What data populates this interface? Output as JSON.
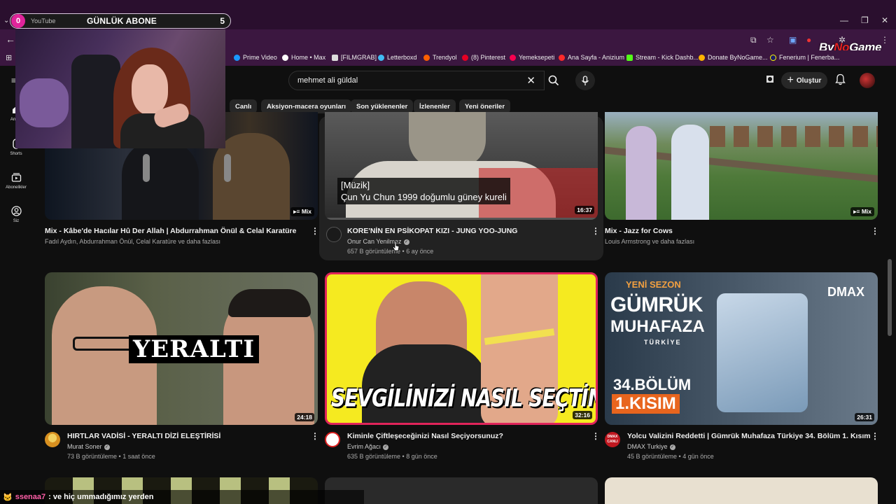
{
  "browser": {
    "tab_badge": "0",
    "tab_site": "YouTube",
    "tab_title": "GÜNLÜK ABONE",
    "tab_count": "5",
    "bookmarks": [
      {
        "label": "Prime Video",
        "color": "#1a98ff"
      },
      {
        "label": "Home • Max",
        "color": "#ffffff"
      },
      {
        "label": "[FILMGRAB]",
        "color": "#dddddd"
      },
      {
        "label": "Letterboxd",
        "color": "#40bcf4"
      },
      {
        "label": "Trendyol",
        "color": "#ff6000"
      },
      {
        "label": "(8) Pinterest",
        "color": "#e60023"
      },
      {
        "label": "Yemeksepeti",
        "color": "#fa0050"
      },
      {
        "label": "Ana Sayfa - Anizium",
        "color": "#ff2a2a"
      },
      {
        "label": "Stream - Kick Dashb...",
        "color": "#53fc18"
      },
      {
        "label": "Donate ByNoGame...",
        "color": "#ffb400"
      },
      {
        "label": "Fenerium | Fenerba...",
        "color": "#1a1a6a"
      }
    ],
    "watermark_a": "By",
    "watermark_b": "No",
    "watermark_c": "Game"
  },
  "header": {
    "search_value": "mehmet ali güldal",
    "create_label": "Oluştur"
  },
  "chips": [
    "Canlı",
    "Aksiyon-macera oyunları",
    "Son yüklenenler",
    "İzlenenler",
    "Yeni öneriler"
  ],
  "guide": [
    {
      "label": "Ana S",
      "icon": "home-icon"
    },
    {
      "label": "Shorts",
      "icon": "shorts-icon"
    },
    {
      "label": "Abonelikler",
      "icon": "subscriptions-icon"
    },
    {
      "label": "Siz",
      "icon": "you-icon"
    }
  ],
  "videos": [
    {
      "title": "Mix - Kâbe'de Hacılar Hû Der Allah | Abdurrahman Önül & Celal Karatüre",
      "meta1": "Fadıl Aydın, Abdurrahman Önül, Celal Karatüre ve daha fazlası",
      "badge": "Mix"
    },
    {
      "title": "KORE'NİN EN PSİKOPAT KIZI - JUNG YOO-JUNG",
      "channel": "Onur Can Yenilmez",
      "stats": "657 B görüntüleme • 6 ay önce",
      "duration": "16:37",
      "overlay_tag": "[Müzik]",
      "overlay_caption": "Çun Yu Chun 1999 doğumlu güney kureli"
    },
    {
      "title": "Mix - Jazz for Cows",
      "meta1": "Louis Armstrong ve daha fazlası",
      "badge": "Mix"
    },
    {
      "title": "HIRTLAR VADİSİ - YERALTI DİZİ ELEŞTİRİSİ",
      "channel": "Murat Soner",
      "stats": "73 B görüntüleme • 1 saat önce",
      "duration": "24:18",
      "thumb_text": "YERALTI"
    },
    {
      "title": "Kiminle Çiftleşeceğinizi Nasıl Seçiyorsunuz?",
      "channel": "Evrim Ağacı",
      "stats": "635 B görüntüleme • 8 gün önce",
      "duration": "32:16",
      "thumb_text": "SEVGİLİNİZİ NASIL SEÇTİNİZ?"
    },
    {
      "title": "Yolcu Valizini Reddetti | Gümrük Muhafaza Türkiye 34. Bölüm 1. Kısım",
      "channel": "DMAX Turkiye",
      "stats": "45 B görüntüleme • 4 gün önce",
      "duration": "26:31",
      "thumb_top": "YENİ SEZON",
      "thumb_title1": "GÜMRÜK",
      "thumb_title2": "MUHAFAZA",
      "thumb_sub": "TÜRKİYE",
      "thumb_ep": "34.BÖLÜM",
      "thumb_part": "1.KISIM",
      "thumb_brand": "DMAX",
      "avatar_text1": "DMAX",
      "avatar_text2": "CANLI"
    }
  ],
  "chat": {
    "user": "ssenaa7",
    "message": ": ve hiç ummadığımız yerden"
  }
}
